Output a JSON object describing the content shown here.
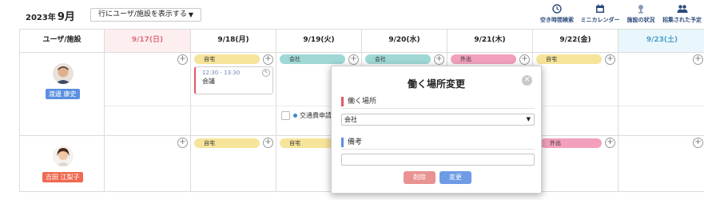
{
  "header": {
    "year": "2023年",
    "month": "9月",
    "display_select": "行にユーザ/施設を表示する",
    "tools": [
      {
        "label": "空き時間検索",
        "icon": "clock-icon"
      },
      {
        "label": "ミニカレンダー",
        "icon": "calendar-icon"
      },
      {
        "label": "施設の状況",
        "icon": "facility-icon"
      },
      {
        "label": "招集された予定",
        "icon": "people-icon"
      }
    ]
  },
  "grid": {
    "corner_label": "ユーザ/施設",
    "days": [
      "9/17(日)",
      "9/18(月)",
      "9/19(火)",
      "9/20(水)",
      "9/21(木)",
      "9/22(金)",
      "9/23(土)"
    ],
    "users": [
      {
        "name": "渡邊 康史",
        "badge_color": "#5b8fe0",
        "places": [
          "",
          "自宅",
          "会社",
          "会社",
          "外出",
          "自宅",
          ""
        ]
      },
      {
        "name": "吉田 江梨子",
        "badge_color": "#ef6a50",
        "places": [
          "",
          "自宅",
          "自宅",
          "",
          "外出",
          "",
          ""
        ]
      }
    ],
    "event": {
      "time": "12:30 - 13:30",
      "name": "会議"
    },
    "task": "交通費申請"
  },
  "dialog": {
    "title": "働く場所変更",
    "place_label": "働く場所",
    "place_value": "会社",
    "note_label": "備考",
    "note_value": "",
    "delete_label": "削除",
    "change_label": "変更"
  },
  "colors": {
    "sunday_bg": "#fdeef0",
    "saturday_bg": "#e9f6fb",
    "home": "#f6e49a",
    "office": "#9fd8d5",
    "out": "#f2a0bd",
    "delete_button": "#e99292",
    "change_button": "#6f9be6",
    "place_accent": "#e05a64",
    "note_accent": "#5b8fe0"
  }
}
